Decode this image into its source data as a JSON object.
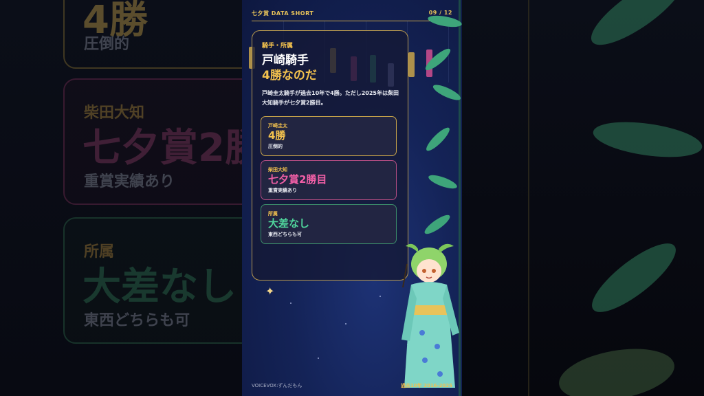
{
  "header": {
    "title": "七夕賞 DATA SHORT",
    "page": "09 / 12"
  },
  "panel": {
    "section_label": "騎手・所属",
    "title_line1": "戸崎騎手",
    "title_line2": "4勝なのだ",
    "description": "戸崎圭太騎手が過去10年で4勝。ただし2025年は柴田大知騎手が七夕賞2勝目。"
  },
  "cards": [
    {
      "label": "戸崎圭太",
      "value": "4勝",
      "sub": "圧倒的",
      "color": "#f2c14e"
    },
    {
      "label": "柴田大知",
      "value": "七夕賞2勝目",
      "sub": "重賞実績あり",
      "color": "#f05fa6"
    },
    {
      "label": "所属",
      "value": "大差なし",
      "sub": "東西どちらも可",
      "color": "#4fd49b"
    }
  ],
  "footer": {
    "credit": "VOICEVOX:ずんだもん",
    "range": "過去10年 2016-2025"
  },
  "background": {
    "card1_big": "4勝",
    "card1_sub": "圧倒的",
    "card2_label": "柴田大知",
    "card2_big": "七夕賞2勝",
    "card2_sub": "重賞実績あり",
    "card3_label": "所属",
    "card3_big": "大差なし",
    "card3_sub": "東西どちらも可"
  },
  "icons": {
    "sparkle": "sparkle-icon",
    "character": "zundamon-character"
  },
  "colors": {
    "gold": "#f2c14e",
    "pink": "#f05fa6",
    "green": "#4fd49b",
    "bg": "#142357"
  }
}
